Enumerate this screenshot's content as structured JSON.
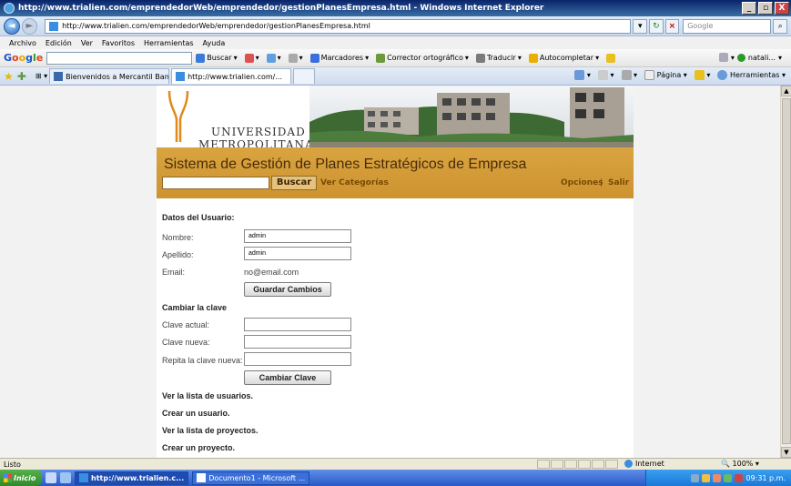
{
  "window": {
    "title": "http://www.trialien.com/emprendedorWeb/emprendedor/gestionPlanesEmpresa.html - Windows Internet Explorer",
    "min": "_",
    "max": "8",
    "close": "X"
  },
  "addressbar": {
    "url": "http://www.trialien.com/emprendedorWeb/emprendedor/gestionPlanesEmpresa.html",
    "search_placeholder": "Google"
  },
  "menu": [
    "Archivo",
    "Edición",
    "Ver",
    "Favoritos",
    "Herramientas",
    "Ayuda"
  ],
  "google_toolbar": {
    "logo": [
      "G",
      "o",
      "o",
      "g",
      "l",
      "e"
    ],
    "items": [
      "Buscar",
      "Marcadores",
      "Corrector ortográfico",
      "Traducir",
      "Autocompletar"
    ],
    "user": "natali..."
  },
  "tabs": [
    {
      "label": "Bienvenidos a Mercantil Banc..."
    },
    {
      "label": "http://www.trialien.com/...",
      "close": "x"
    }
  ],
  "tab_tools": [
    "Página",
    "Herramientas"
  ],
  "banner": {
    "line1": "UNIVERSIDAD",
    "line2": "METROPOLITANA"
  },
  "header": {
    "title": "Sistema de Gestión de Planes Estratégicos de Empresa",
    "search_button": "Buscar",
    "categories_link": "Ver Categorías",
    "options_link": "Opciones",
    "separator": "|",
    "exit_link": "Salir"
  },
  "user_form": {
    "section_title": "Datos del Usuario:",
    "name_label": "Nombre:",
    "name_value": "admin",
    "lastname_label": "Apellido:",
    "lastname_value": "admin",
    "email_label": "Email:",
    "email_value": "no@email.com",
    "save_button": "Guardar Cambios"
  },
  "password_form": {
    "section_title": "Cambiar la clave",
    "current_label": "Clave actual:",
    "new_label": "Clave nueva:",
    "repeat_label": "Repita la clave nueva:",
    "change_button": "Cambiar Clave"
  },
  "links": [
    "Ver la lista de usuarios.",
    "Crear un usuario.",
    "Ver la lista de proyectos.",
    "Crear un proyecto."
  ],
  "statusbar": {
    "status": "Listo",
    "zone": "Internet",
    "zoom": "100%"
  },
  "taskbar": {
    "start": "Inicio",
    "tasks": [
      "http://www.trialien.c...",
      "Documento1 - Microsoft ..."
    ],
    "clock": "09:31 p.m."
  },
  "colors": {
    "header_gold": "#d9a440",
    "header_text": "#4a2c08",
    "link_brown": "#7a4a00"
  }
}
